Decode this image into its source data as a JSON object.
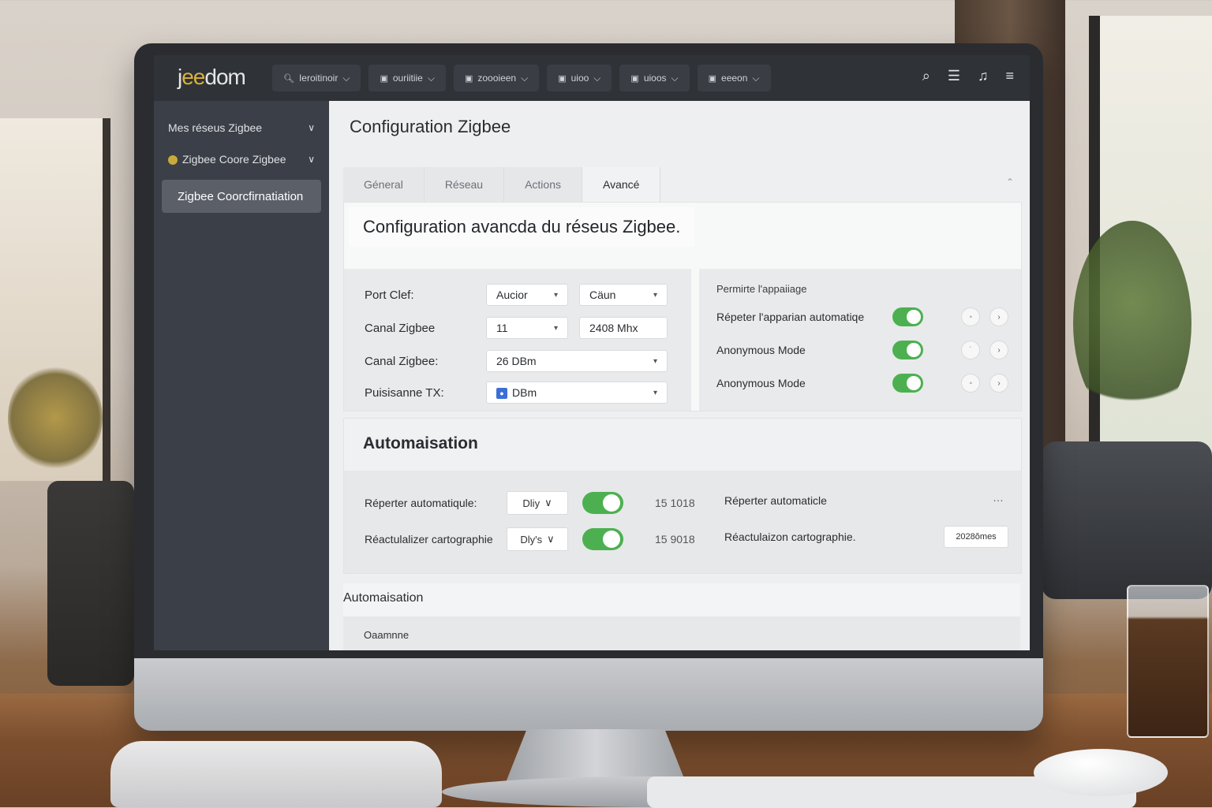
{
  "app": {
    "logo_prefix": "j",
    "logo_accent": "ee",
    "logo_suffix": "dom"
  },
  "topnav": {
    "items": [
      {
        "label": "Ieroitinoir",
        "icon": "search-icon"
      },
      {
        "label": "ouriitiie"
      },
      {
        "label": "zoooieen"
      },
      {
        "label": "uioo"
      },
      {
        "label": "uioos"
      },
      {
        "label": "eeeon"
      }
    ]
  },
  "sidebar": {
    "items": [
      {
        "label": "Mes réseus Zigbee"
      },
      {
        "label": "Zigbee Coore Zigbee"
      }
    ],
    "active": "Zigbee Coorcfirnatiation"
  },
  "page": {
    "title": "Configuration Zigbee"
  },
  "tabs": [
    {
      "label": "Géneral"
    },
    {
      "label": "Réseau"
    },
    {
      "label": "Actions"
    },
    {
      "label": "Avancé"
    }
  ],
  "advanced": {
    "title": "Configuration avancda du réseus Zigbee.",
    "rows": [
      {
        "label": "Port Clef:",
        "field1": "Aucior",
        "field2": "Cäun"
      },
      {
        "label": "Canal Zigbee",
        "field1": "11",
        "field2": "2408 Mhx"
      },
      {
        "label": "Canal Zigbee:",
        "field1": "26 DBm"
      },
      {
        "label": "Puisisanne TX:",
        "field1": "DBm"
      }
    ],
    "permit_label": "Permirte l'appaiiage",
    "toggles": [
      {
        "label": "Répeter l'apparian automatiqe",
        "on": true
      },
      {
        "label": "Anonymous Mode",
        "on": true
      },
      {
        "label": "Anonymous Mode",
        "on": true
      }
    ]
  },
  "automation": {
    "title": "Automaisation",
    "rows": [
      {
        "label": "Réperter automatiqule:",
        "select": "Dliy",
        "on": true,
        "num": "15  1018",
        "right_label": "Réperter automaticle"
      },
      {
        "label": "Réactulalizer cartographie",
        "select": "Dly's",
        "on": true,
        "num": "15  9018",
        "right_label": "Réactulaizon cartographie."
      }
    ],
    "right_value": "2028ŏmes"
  },
  "section2": {
    "title": "Automaisation",
    "row": "Oaamnne"
  },
  "colors": {
    "toggle_on": "#4cb050",
    "topbar": "#2f3237",
    "sidebar": "#3b3f47",
    "logo_accent": "#d9b23a"
  }
}
